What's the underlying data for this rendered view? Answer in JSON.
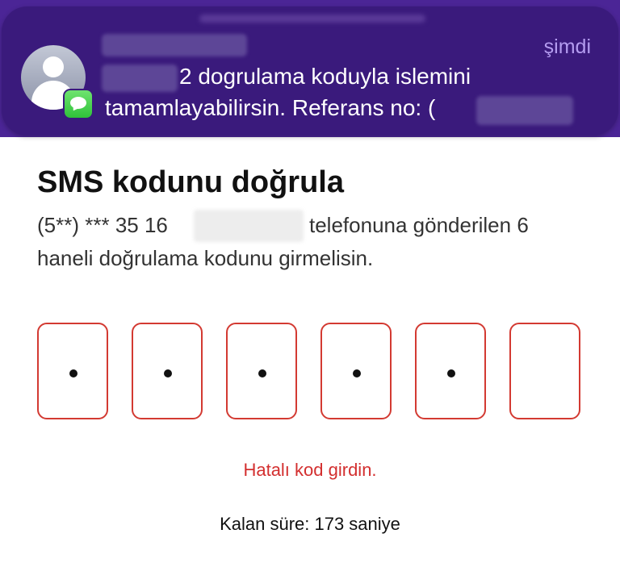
{
  "notification": {
    "time": "şimdi",
    "line1": "2 dogrulama koduyla islemini",
    "line2": "tamamlayabilirsin. Referans no: (",
    "icon": "user-avatar-icon",
    "badge_icon": "messages-app-icon",
    "badge_color": "#34c759"
  },
  "page": {
    "title": "SMS kodunu doğrula",
    "phone_prefix": "(5**) *** 35 16",
    "desc_after_phone": "telefonuna gönderilen 6",
    "desc_line2": "haneli doğrulama kodunu girmelisin."
  },
  "code": {
    "length": 6,
    "filled": 5,
    "masked_char": "•",
    "error_color": "#d33a32"
  },
  "status": {
    "error": "Hatalı kod girdin.",
    "timer": "Kalan süre: 173 saniye"
  },
  "colors": {
    "brand": "#4b2596",
    "notification_bg": "#3a1a7c",
    "accent_text": "#b49cf0"
  }
}
